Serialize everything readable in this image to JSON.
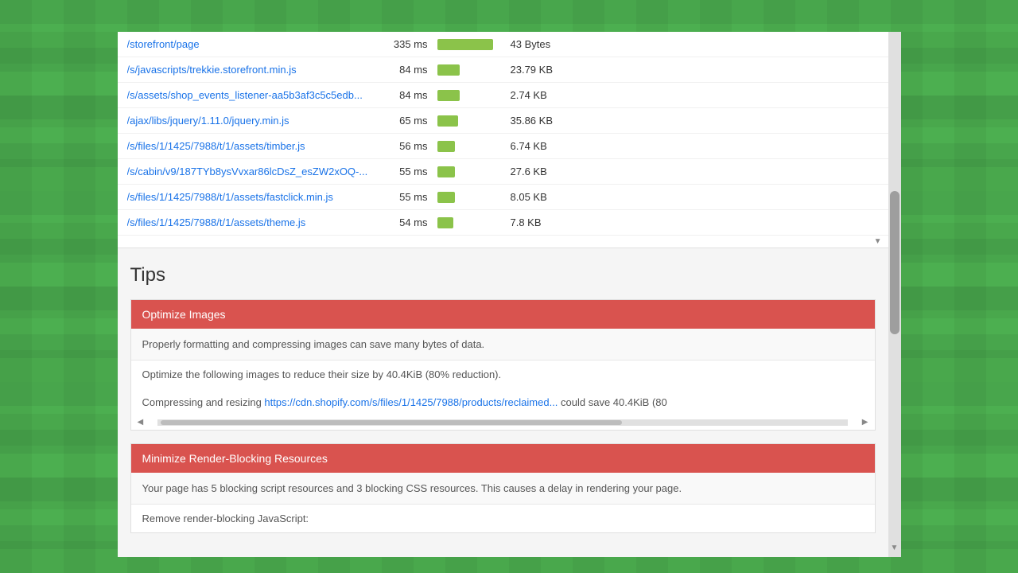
{
  "page": {
    "background_color": "#4caf50"
  },
  "resource_table": {
    "rows": [
      {
        "url": "/storefront/page",
        "time": "335 ms",
        "bar_class": "bar-large",
        "size": "43 Bytes"
      },
      {
        "url": "/s/javascripts/trekkie.storefront.min.js",
        "time": "84 ms",
        "bar_class": "bar-medium",
        "size": "23.79 KB"
      },
      {
        "url": "/s/assets/shop_events_listener-aa5b3af3c5c5edb...",
        "time": "84 ms",
        "bar_class": "bar-medium",
        "size": "2.74 KB"
      },
      {
        "url": "/ajax/libs/jquery/1.11.0/jquery.min.js",
        "time": "65 ms",
        "bar_class": "bar-medium-sm",
        "size": "35.86 KB"
      },
      {
        "url": "/s/files/1/1425/7988/t/1/assets/timber.js",
        "time": "56 ms",
        "bar_class": "bar-small",
        "size": "6.74 KB"
      },
      {
        "url": "/s/cabin/v9/187TYb8ysVvxar86lcDsZ_esZW2xOQ-...",
        "time": "55 ms",
        "bar_class": "bar-small",
        "size": "27.6 KB"
      },
      {
        "url": "/s/files/1/1425/7988/t/1/assets/fastclick.min.js",
        "time": "55 ms",
        "bar_class": "bar-small",
        "size": "8.05 KB"
      },
      {
        "url": "/s/files/1/1425/7988/t/1/assets/theme.js",
        "time": "54 ms",
        "bar_class": "bar-xs",
        "size": "7.8 KB"
      }
    ]
  },
  "tips": {
    "title": "Tips",
    "cards": [
      {
        "id": "optimize-images",
        "header": "Optimize Images",
        "description": "Properly formatting and compressing images can save many bytes of data.",
        "detail_text": "Optimize the following images to reduce their size by 40.4KiB (80% reduction).",
        "detail_link_prefix": "Compressing and resizing ",
        "detail_link": "https://cdn.shopify.com/s/files/1/1425/7988/products/reclaimed...",
        "detail_link_suffix": " could save 40.4KiB (80"
      },
      {
        "id": "minimize-render-blocking",
        "header": "Minimize Render-Blocking Resources",
        "description": "Your page has 5 blocking script resources and 3 blocking CSS resources. This causes a delay in rendering your page.",
        "detail_text": "Remove render-blocking JavaScript:"
      }
    ]
  }
}
